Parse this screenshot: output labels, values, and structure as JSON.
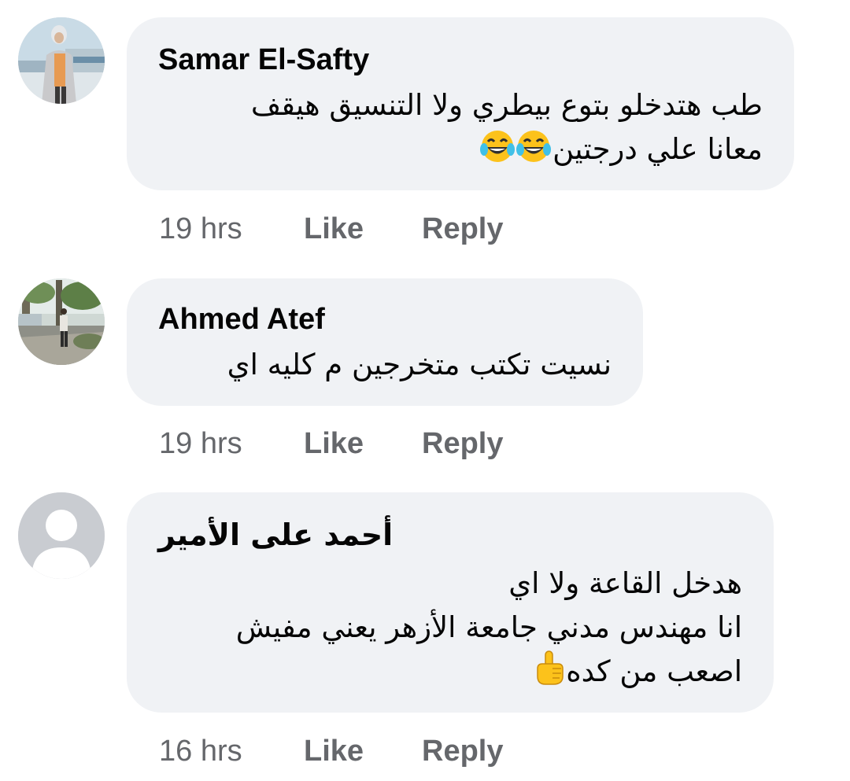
{
  "comments": [
    {
      "author": "Samar El-Safty",
      "avatar_icon": "profile-photo-woman",
      "lines": [
        "طب هتدخلو بتوع بيطري ولا التنسيق هيقف",
        "معانا علي درجتين"
      ],
      "emoji": "tears-of-joy-emoji",
      "emoji_count": 2,
      "time": "19 hrs",
      "like_label": "Like",
      "reply_label": "Reply"
    },
    {
      "author": "Ahmed Atef",
      "avatar_icon": "profile-photo-man-outdoors",
      "lines": [
        "نسيت تكتب متخرجين م كليه اي"
      ],
      "time": "19 hrs",
      "like_label": "Like",
      "reply_label": "Reply"
    },
    {
      "author": "أحمد على الأمير",
      "avatar_icon": "default-avatar-icon",
      "lines": [
        "هدخل القاعة ولا اي",
        "انا مهندس مدني جامعة الأزهر يعني مفيش",
        "اصعب من كده"
      ],
      "emoji": "pointing-up-emoji",
      "emoji_count": 1,
      "time": "16 hrs",
      "like_label": "Like",
      "reply_label": "Reply"
    }
  ],
  "colors": {
    "bubble": "#f0f2f5",
    "meta_text": "#65676b",
    "author_text": "#050505"
  }
}
